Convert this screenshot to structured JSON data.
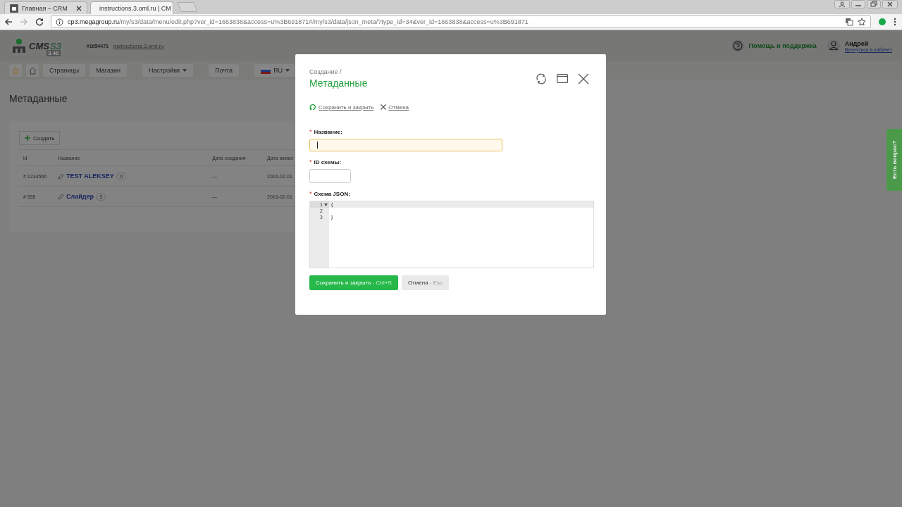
{
  "browser": {
    "tabs": [
      {
        "title": "Главная – CRM",
        "selected": false
      },
      {
        "title": "instructions.3.oml.ru | CM",
        "selected": true
      }
    ],
    "url_host": "cp3.megagroup.ru",
    "url_path": "/my/s3/data/menu/edit.php?ver_id=1663838&access=u%3B691871#/my/s3/data/json_meta/?type_id=34&ver_id=1663838&access=u%3B691871"
  },
  "header": {
    "logo": "CMS",
    "logo_accent": "S3",
    "version": "3.46",
    "site_id": "#1654471",
    "site_link": "instructions.3.oml.ru",
    "help": "Помощь и поддержка",
    "user_name": "Андрей",
    "user_link": "Вернуться в кабинет"
  },
  "nav": {
    "items": [
      {
        "label": "Страницы",
        "kind": "button"
      },
      {
        "label": "Магазин",
        "kind": "button"
      },
      {
        "label": "Настройки",
        "kind": "dropdown"
      },
      {
        "label": "Почта",
        "kind": "button"
      },
      {
        "label": "RU",
        "kind": "language"
      }
    ]
  },
  "page": {
    "title": "Метаданные",
    "create_button": "Создать",
    "table": {
      "columns": [
        "id",
        "Название",
        "Дата создания",
        "Дата измен"
      ],
      "rows": [
        {
          "id": "# 1234566",
          "name": "TEST ALEKSEY",
          "count": "0",
          "created": "—",
          "modified": "2016-02-01"
        },
        {
          "id": "# 555",
          "name": "Слайдер",
          "count": "3",
          "created": "—",
          "modified": "2016-02-01"
        }
      ]
    }
  },
  "modal": {
    "breadcrumb": "Создание /",
    "title": "Метаданные",
    "save_link": "Сохранить и закрыть",
    "cancel_link": "Отмена",
    "fields": [
      {
        "mark": "*",
        "label": "Название:",
        "focused": true,
        "kind": "wide"
      },
      {
        "mark": "*",
        "label": "ID схемы:",
        "focused": false,
        "kind": "short"
      }
    ],
    "editor": {
      "mark": "*",
      "label": "Схема JSON:",
      "lines": [
        {
          "number": "1",
          "text": "{",
          "foldable": true
        },
        {
          "number": "2",
          "foldable": false
        },
        {
          "number": "3",
          "text": "}",
          "foldable": false
        }
      ]
    },
    "buttons": [
      {
        "label": "Сохранить и закрыть",
        "hint": "- Ctrl+S",
        "kind": "primary"
      },
      {
        "label": "Отмена",
        "hint": "- Esc",
        "kind": "secondary"
      }
    ]
  },
  "side_tab": "Есть вопрос?"
}
